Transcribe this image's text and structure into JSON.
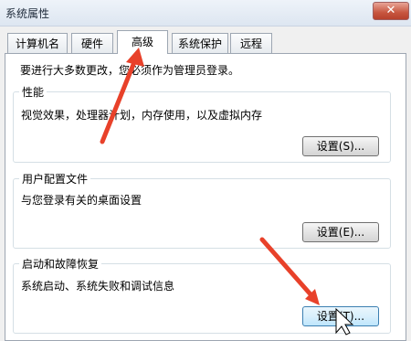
{
  "window": {
    "title": "系统属性",
    "close_label": "✕"
  },
  "tabs": [
    {
      "label": "计算机名",
      "active": false
    },
    {
      "label": "硬件",
      "active": false
    },
    {
      "label": "高级",
      "active": true
    },
    {
      "label": "系统保护",
      "active": false
    },
    {
      "label": "远程",
      "active": false
    }
  ],
  "notice": "要进行大多数更改，您必须作为管理员登录。",
  "groups": [
    {
      "title": "性能",
      "description": "视觉效果，处理器计划，内存使用，以及虚拟内存",
      "button": "设置(S)..."
    },
    {
      "title": "用户配置文件",
      "description": "与您登录有关的桌面设置",
      "button": "设置(E)..."
    },
    {
      "title": "启动和故障恢复",
      "description": "系统启动、系统失败和调试信息",
      "button": "设置(T)..."
    }
  ],
  "annotations": {
    "arrow_color": "#e8412a"
  }
}
